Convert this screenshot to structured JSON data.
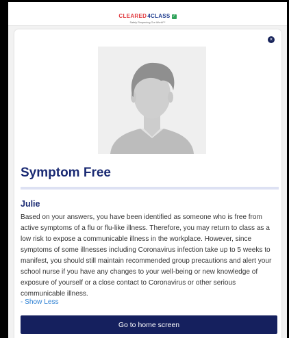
{
  "brand": {
    "name_part1": "CLEARED",
    "name_part2": "4CLASS",
    "check_glyph": "✓",
    "tagline": "Safely Reopening Our World™"
  },
  "modal": {
    "close_glyph": "×",
    "avatar_icon": "user-silhouette-icon",
    "title": "Symptom Free",
    "name": "Julie",
    "body": "Based on your answers, you have been identified as someone who is free from active symptoms of a flu or flu-like illness. Therefore, you may return to class as a low risk to expose a communicable illness in the workplace. However, since symptoms of some illnesses including Coronavirus infection take up to 5 weeks to manifest, you should still maintain recommended group precautions and alert your school nurse if you have any changes to your well-being or new knowledge of exposure of yourself or a close contact to Coronavirus or other serious communicable illness.",
    "show_less": "- Show Less",
    "home_button": "Go to home screen"
  },
  "colors": {
    "primary": "#15205e",
    "heading": "#1a2a73",
    "link": "#2b7fd3",
    "divider": "#dde1f3",
    "brand_red": "#e0393e",
    "brand_blue": "#1f3d8f",
    "brand_green": "#2fa35a"
  }
}
